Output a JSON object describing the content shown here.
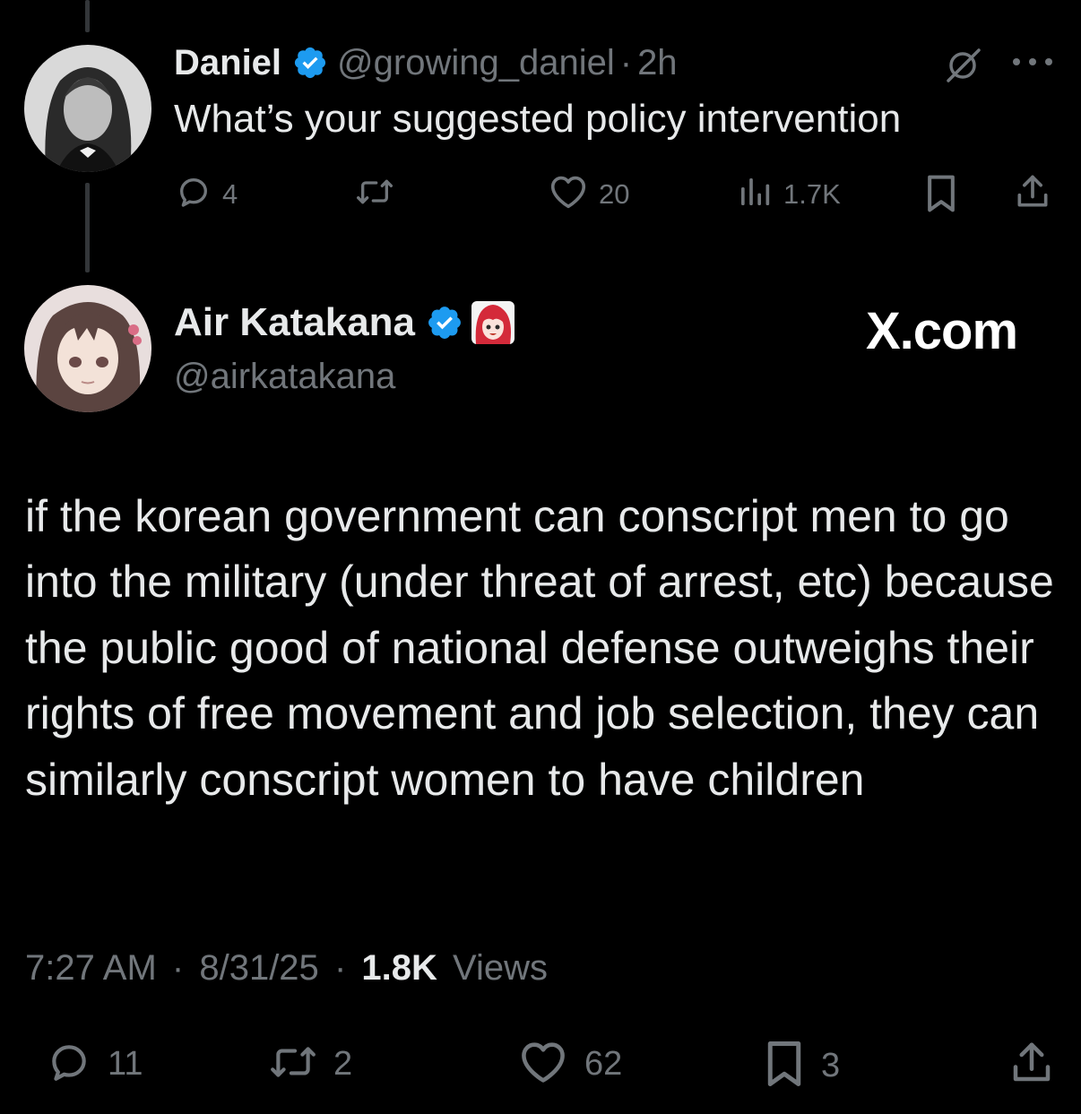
{
  "parent_tweet": {
    "display_name": "Daniel",
    "handle": "@growing_daniel",
    "separator": "·",
    "time_ago": "2h",
    "text": "What’s your suggested policy intervention",
    "actions": {
      "replies": "4",
      "reposts": "",
      "likes": "20",
      "views": "1.7K"
    },
    "icons": [
      "grok-icon",
      "more-icon",
      "reply-icon",
      "repost-icon",
      "like-icon",
      "views-icon",
      "bookmark-icon",
      "share-icon"
    ]
  },
  "main_tweet": {
    "display_name": "Air Katakana",
    "handle": "@airkatakana",
    "watermark": "X.com",
    "text": "if the korean government can conscript men to go into the military (under threat of arrest, etc) because the public good of national defense outweighs their rights of free movement and job selection, they can similarly conscript women to have children",
    "time": "7:27 AM",
    "date": "8/31/25",
    "separator": "·",
    "views_count": "1.8K",
    "views_label": "Views",
    "actions": {
      "replies": "11",
      "reposts": "2",
      "likes": "62",
      "bookmarks": "3"
    }
  },
  "colors": {
    "background": "#000000",
    "text_primary": "#e7e9ea",
    "text_secondary": "#71767b",
    "verified_blue": "#1d9bf0",
    "thread_line": "#333639"
  }
}
